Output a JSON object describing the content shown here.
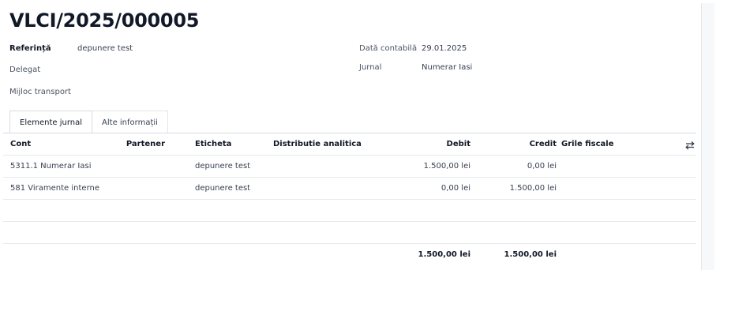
{
  "document": {
    "title": "VLCI/2025/000005"
  },
  "fields": {
    "referinta": {
      "label": "Referință",
      "value": "depunere test"
    },
    "delegat": {
      "label": "Delegat",
      "value": ""
    },
    "mijloc_transport": {
      "label": "Mijloc transport",
      "value": ""
    },
    "data_contabila": {
      "label": "Dată contabilă",
      "value": "29.01.2025"
    },
    "jurnal": {
      "label": "Jurnal",
      "value": "Numerar Iasi"
    }
  },
  "tabs": [
    {
      "label": "Elemente jurnal",
      "active": true
    },
    {
      "label": "Alte informații",
      "active": false
    }
  ],
  "table": {
    "columns": {
      "cont": "Cont",
      "partener": "Partener",
      "eticheta": "Eticheta",
      "distributie": "Distributie analitica",
      "debit": "Debit",
      "credit": "Credit",
      "grile": "Grile fiscale"
    },
    "settings_icon": "sliders-icon",
    "rows": [
      {
        "cont": "5311.1 Numerar Iasi",
        "partener": "",
        "eticheta": "depunere test",
        "distributie": "",
        "debit": "1.500,00 lei",
        "credit": "0,00 lei",
        "grile": ""
      },
      {
        "cont": "581 Viramente interne",
        "partener": "",
        "eticheta": "depunere test",
        "distributie": "",
        "debit": "0,00 lei",
        "credit": "1.500,00 lei",
        "grile": ""
      }
    ],
    "totals": {
      "debit": "1.500,00 lei",
      "credit": "1.500,00 lei"
    }
  }
}
